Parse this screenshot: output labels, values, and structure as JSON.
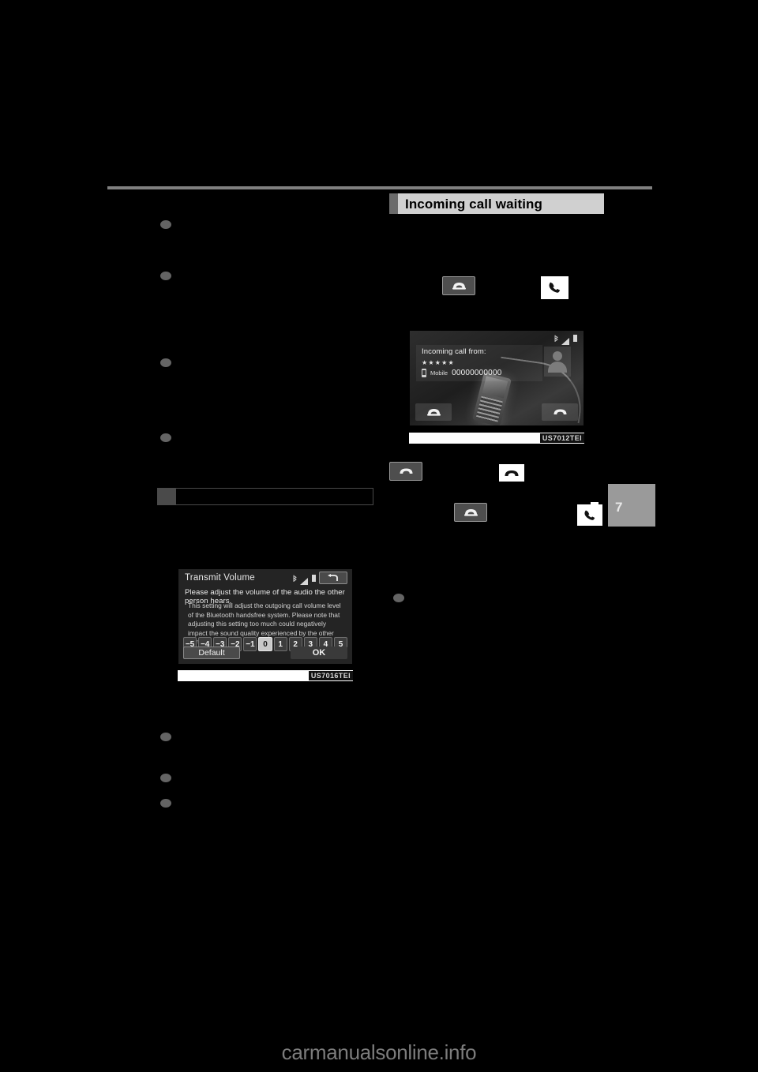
{
  "document": {
    "page_number": "7",
    "watermark": "carmanualsonline.info"
  },
  "sections": {
    "incoming_call_waiting": "Incoming call waiting"
  },
  "screens": {
    "incoming_call": {
      "caption_code": "US7012TEI",
      "title": "Incoming call from:",
      "masked_name": "★★★★★",
      "number_label": "Mobile",
      "number_value": "00000000000",
      "status_icons": [
        "bluetooth-icon",
        "signal-icon",
        "battery-icon"
      ],
      "softkey_left_icon": "answer-call-icon",
      "softkey_right_icon": "end-call-icon"
    },
    "transmit_volume": {
      "caption_code": "US7016TEI",
      "title": "Transmit Volume",
      "subtitle": "Please adjust the volume of the audio the other person hears.",
      "body": "This setting will adjust the outgoing call volume level of the Bluetooth handsfree system. Please note that adjusting this setting too much could negatively impact the sound quality experienced by the other party.",
      "scale_values": [
        "−5",
        "−4",
        "−3",
        "−2",
        "−1",
        "0",
        "1",
        "2",
        "3",
        "4",
        "5"
      ],
      "selected_value": "0",
      "default_label": "Default",
      "ok_label": "OK",
      "back_icon": "back-arrow-icon",
      "status_icons": [
        "bluetooth-icon",
        "signal-icon",
        "battery-icon"
      ]
    }
  },
  "inline_icons": [
    {
      "name": "answer-call-button-dark",
      "style": "dark",
      "glyph": "off-hook-handset"
    },
    {
      "name": "phone-handset-icon-light",
      "style": "light",
      "glyph": "handset-tilted"
    },
    {
      "name": "end-call-button-dark",
      "style": "dark",
      "glyph": "on-hook-handset"
    },
    {
      "name": "end-call-icon-light",
      "style": "light",
      "glyph": "on-hook-handset"
    },
    {
      "name": "answer-call-button-dark-2",
      "style": "dark",
      "glyph": "off-hook-handset"
    },
    {
      "name": "phone-handset-icon-light-2",
      "style": "light",
      "glyph": "handset-tilted"
    }
  ],
  "colors": {
    "page_background": "#000000",
    "section_header_bg": "#d0d0d0",
    "section_header_tab": "#6a6a6a",
    "rule": "#808080",
    "bullet": "#646464",
    "page_tab": "#9a9a9a",
    "watermark": "#7c7c7c"
  }
}
